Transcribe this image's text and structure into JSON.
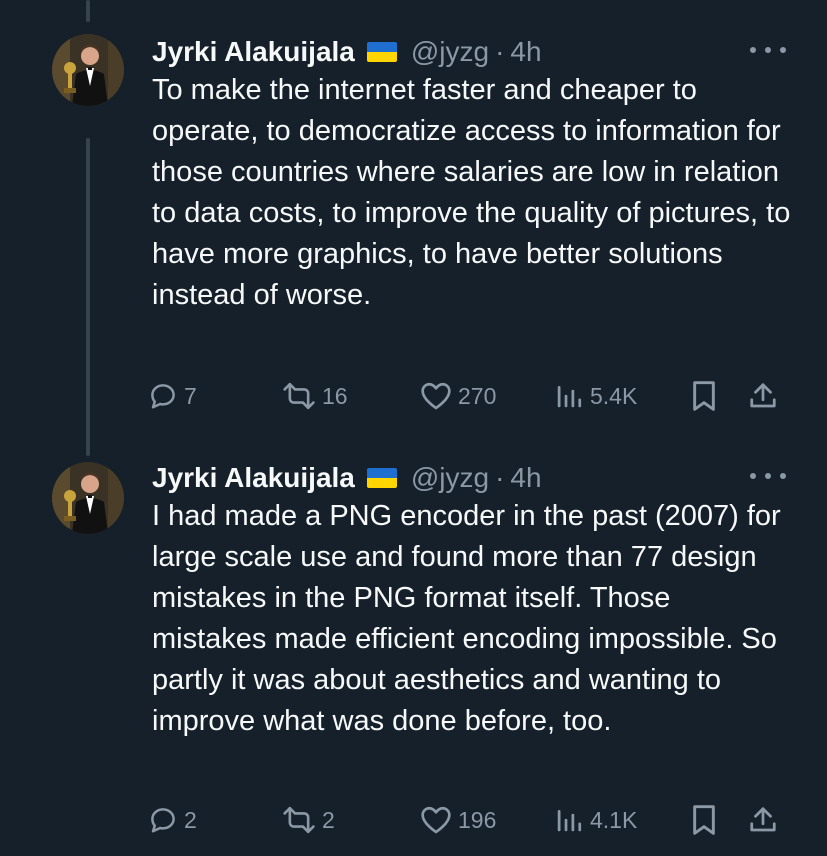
{
  "tweets": [
    {
      "author_name": "Jyrki Alakuijala",
      "flag": "ukraine-flag",
      "handle": "@jyzg",
      "separator": "·",
      "time": "4h",
      "text": "To make the internet faster and cheaper to operate, to democratize access to information for those countries where salaries are low in relation to data costs, to improve the quality of pictures, to have more graphics, to have better solutions instead of worse.",
      "replies": "7",
      "retweets": "16",
      "likes": "270",
      "views": "5.4K"
    },
    {
      "author_name": "Jyrki Alakuijala",
      "flag": "ukraine-flag",
      "handle": "@jyzg",
      "separator": "·",
      "time": "4h",
      "text": "I had made a PNG encoder in the past (2007) for large scale use and found more than 77 design mistakes in the PNG format itself. Those mistakes made efficient encoding impossible. So partly it was about aesthetics and wanting to improve what was done before, too.",
      "replies": "2",
      "retweets": "2",
      "likes": "196",
      "views": "4.1K"
    }
  ],
  "colors": {
    "background": "#15202b",
    "text_primary": "#f7f9f9",
    "text_secondary": "#8b98a5",
    "thread_line": "#38444d"
  }
}
